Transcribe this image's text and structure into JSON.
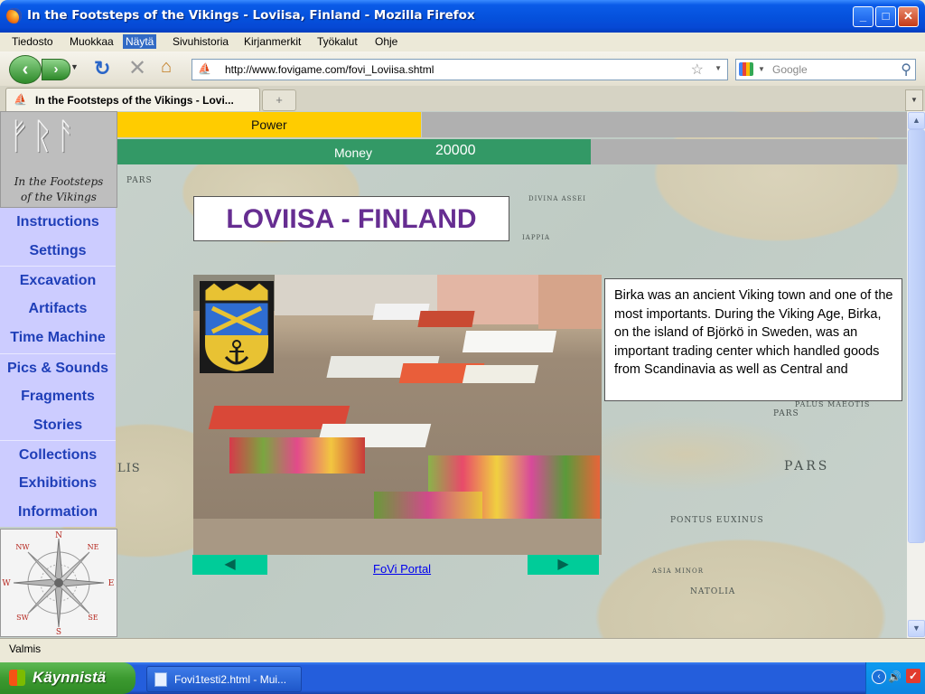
{
  "window": {
    "title": "In the Footsteps of the Vikings - Loviisa, Finland - Mozilla Firefox",
    "minimize_glyph": "_",
    "maximize_glyph": "□",
    "close_glyph": "✕"
  },
  "menu": {
    "items": [
      "Tiedosto",
      "Muokkaa",
      "Näytä",
      "Sivuhistoria",
      "Kirjanmerkit",
      "Työkalut",
      "Ohje"
    ],
    "active": "Näytä"
  },
  "nav": {
    "url": "http://www.fovigame.com/fovi_Loviisa.shtml",
    "search_placeholder": "Google"
  },
  "tabs": {
    "active_title": "In the Footsteps of the Vikings - Lovi...",
    "new_tab_glyph": "+"
  },
  "game": {
    "power_label": "Power",
    "money_label": "Money",
    "money_value": "20000",
    "logo_line1": "In the Footsteps",
    "logo_line2": "of the Vikings",
    "logo_runes": "ᚠᚱᚨ",
    "side_nav": [
      "Instructions",
      "Settings",
      "Excavation",
      "Artifacts",
      "Time Machine",
      "Pics & Sounds",
      "Fragments",
      "Stories",
      "Collections",
      "Exhibitions",
      "Information"
    ],
    "compass_labels": {
      "n": "N",
      "ne": "NE",
      "e": "E",
      "se": "SE",
      "s": "S",
      "sw": "SW",
      "w": "W",
      "nw": "NW"
    },
    "location_title": "LOVIISA - FINLAND",
    "description": "Birka was an ancient Viking town and one of the most importants. During the Viking Age, Birka, on the island of Björkö in Sweden, was an important trading center which handled goods from Scandinavia as well as Central and",
    "prev_glyph": "◀",
    "next_glyph": "▶",
    "portal_link": "FoVi Portal",
    "map_labels": [
      "PARS",
      "PARS",
      "PONTUS EUXINUS",
      "LIS",
      "DIVINA ASSEI",
      "IAPPIA",
      "PALUS MAEOTIS",
      "ASIA MINOR",
      "NATOLIA",
      "PARS"
    ],
    "colors": {
      "power": "#FFCC00",
      "money": "#339966",
      "nav_bg": "#CCCCFF",
      "nav_text": "#1F3FB8",
      "title": "#662D91",
      "arrow_btn": "#00CC99"
    }
  },
  "status": {
    "text": "Valmis"
  },
  "taskbar": {
    "start_label": "Käynnistä",
    "item_label": "Fovi1testi2.html - Mui..."
  }
}
